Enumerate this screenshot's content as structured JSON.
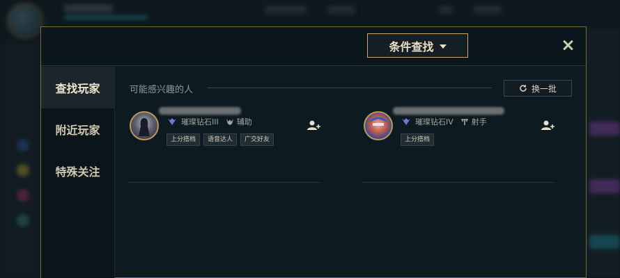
{
  "header": {
    "filter_button_label": "条件查找"
  },
  "sidebar": {
    "items": [
      {
        "label": "查找玩家",
        "active": true
      },
      {
        "label": "附近玩家",
        "active": false
      },
      {
        "label": "特殊关注",
        "active": false
      }
    ]
  },
  "main": {
    "section_title": "可能感兴趣的人",
    "refresh_label": "换一批",
    "players": [
      {
        "rank": "璀璨钻石III",
        "role": "辅助",
        "role_icon": "support-icon",
        "tags": [
          "上分搭档",
          "语音达人",
          "广交好友"
        ]
      },
      {
        "rank": "璀璨钻石IV",
        "role": "射手",
        "role_icon": "marksman-icon",
        "tags": [
          "上分搭档"
        ]
      }
    ]
  },
  "colors": {
    "gold_border": "#c8aa6e",
    "panel_bg": "#0d1a21",
    "text_primary": "#f0e6d2"
  }
}
